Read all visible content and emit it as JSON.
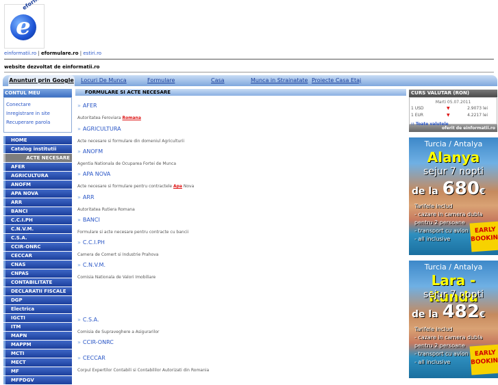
{
  "logo": {
    "letter": "e",
    "tag": "eformulare.ro"
  },
  "toplinks": {
    "link1": "einformatii.ro",
    "sep1": " | ",
    "link2": "eformulare.ro",
    "sep2": " | ",
    "link3": "estiri.ro"
  },
  "dev_line": "website dezvoltat de einformatii.ro",
  "nav": {
    "google": "Anunturi prin Google",
    "items": [
      "Locuri De Munca",
      "Formulare",
      "Casa",
      "Munca in Strainatate",
      "Proiecte Casa Etaj"
    ]
  },
  "account": {
    "header": "CONTUL MEU",
    "links": [
      "Conectare",
      "Inregistrare in site",
      "Recuperare parola"
    ]
  },
  "menu": [
    "HOME",
    "Catalog institutii",
    "ACTE NECESARE",
    "AFER",
    "AGRICULTURA",
    "ANOFM",
    "APA NOVA",
    "ARR",
    "BANCI",
    "C.C.I.PH",
    "C.N.V.M.",
    "C.S.A.",
    "CCIR-ONRC",
    "CECCAR",
    "CNAS",
    "CNPAS",
    "CONTABILITATE",
    "DECLARATII FISCALE",
    "DGP",
    "Electrica",
    "IGCTI",
    "ITM",
    "MAPN",
    "MAPPM",
    "MCTI",
    "MECT",
    "MF",
    "MFPDGV"
  ],
  "main": {
    "header": "FORMULARE SI ACTE NECESARE",
    "entries": [
      {
        "title": "AFER",
        "desc": "Autoritatea Feroviara ",
        "hl": "Romana",
        "tail": ""
      },
      {
        "title": "AGRICULTURA",
        "desc": "Acte necesare si formulare din domeniul Agriculturii",
        "hl": "",
        "tail": ""
      },
      {
        "title": "ANOFM",
        "desc": "Agentia Nationala de Ocuparea Fortei de Munca",
        "hl": "",
        "tail": ""
      },
      {
        "title": "APA NOVA",
        "desc": "Acte necesare si formulare pentru contractele ",
        "hl": "Apa",
        "tail": " Nova"
      },
      {
        "title": "ARR",
        "desc": "Autoritatea Rutiera Romana",
        "hl": "",
        "tail": ""
      },
      {
        "title": "BANCI",
        "desc": "Formulare si acte necesare pentru contracte cu bancii",
        "hl": "",
        "tail": ""
      },
      {
        "title": "C.C.I.PH",
        "desc": "Camera de Comert si Industrie Prahova",
        "hl": "",
        "tail": ""
      },
      {
        "title": "C.N.V.M.",
        "desc": "Comisia Nationala de Valori Imobiliare",
        "hl": "",
        "tail": ""
      },
      {
        "title": "C.S.A.",
        "desc": "Comisia de Supraveghere a Asigurarilor",
        "hl": "",
        "tail": ""
      },
      {
        "title": "CCIR-ONRC",
        "desc": "",
        "hl": "",
        "tail": ""
      },
      {
        "title": "CECCAR",
        "desc": "Corpul Expertilor Contabili si Contabililor Autorizati din Romania",
        "hl": "",
        "tail": ""
      }
    ]
  },
  "currency": {
    "header": "CURS VALUTAR (RON)",
    "date": "Marti 05.07.2011",
    "rows": [
      {
        "label": "1 USD",
        "value": "2.9073 lei"
      },
      {
        "label": "1 EUR",
        "value": "4.2217 lei"
      }
    ],
    "link": ":: Toate valutele",
    "footer": "oferit de einformatii.ro"
  },
  "ads": [
    {
      "line1": "Turcia / Antalya",
      "dest": "Alanya",
      "nights": "sejur 7 nopti",
      "from": "de la",
      "price": "680",
      "cur": "€",
      "features": [
        "Tarifele includ",
        "- cazare in camera dubla",
        "  pentru 2 persoane",
        "- transport cu avion",
        "- all inclusive"
      ],
      "badge1": "EARLY",
      "badge2": "BOOKING"
    },
    {
      "line1": "Turcia / Antalya",
      "dest": "Lara - Kundu",
      "nights": "sejur 7 nopti",
      "from": "de la",
      "price": "482",
      "cur": "€",
      "features": [
        "Tarifele includ",
        "- cazare in camera dubla",
        "  pentru 2 persoane",
        "- transport cu avion",
        "- all inclusive"
      ],
      "badge1": "EARLY",
      "badge2": "BOOKING"
    }
  ]
}
